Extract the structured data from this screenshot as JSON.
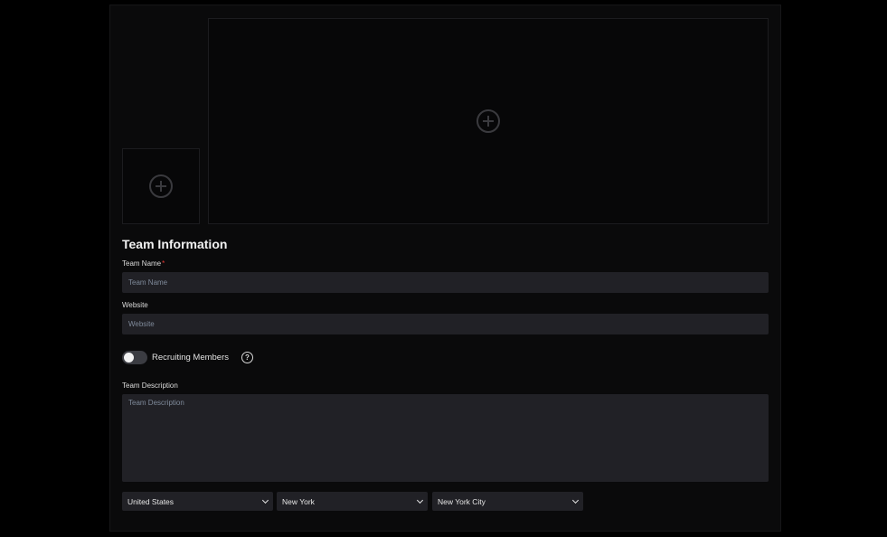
{
  "uploads": {
    "avatar_icon": "plus-circle-icon",
    "banner_icon": "plus-circle-icon"
  },
  "form": {
    "section_title": "Team Information",
    "team_name": {
      "label": "Team Name",
      "required_mark": "*",
      "placeholder": "Team Name",
      "value": ""
    },
    "website": {
      "label": "Website",
      "placeholder": "Website",
      "value": ""
    },
    "recruiting": {
      "label": "Recruiting Members",
      "enabled": false,
      "help_icon": "question-circle-icon",
      "help_glyph": "?"
    },
    "description": {
      "label": "Team Description",
      "placeholder": "Team Description",
      "value": ""
    },
    "location": {
      "country": "United States",
      "state": "New York",
      "city": "New York City"
    }
  }
}
